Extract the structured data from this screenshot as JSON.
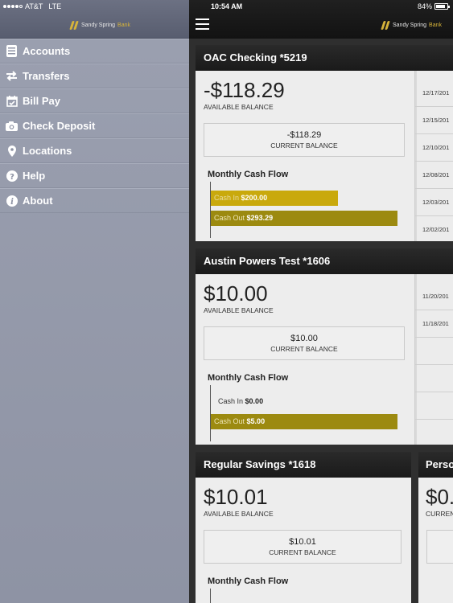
{
  "status_bar": {
    "carrier": "AT&T",
    "network": "LTE",
    "time": "10:54 AM",
    "battery": "84%",
    "battery_level": 0.84
  },
  "brand": {
    "name": "Sandy Spring",
    "suffix": "Bank"
  },
  "sidebar": {
    "items": [
      {
        "label": "Accounts",
        "icon": "accounts-icon"
      },
      {
        "label": "Transfers",
        "icon": "transfer-arrows-icon"
      },
      {
        "label": "Bill Pay",
        "icon": "calendar-check-icon"
      },
      {
        "label": "Check Deposit",
        "icon": "camera-icon"
      },
      {
        "label": "Locations",
        "icon": "map-pin-icon"
      },
      {
        "label": "Help",
        "icon": "question-icon"
      },
      {
        "label": "About",
        "icon": "info-icon"
      }
    ]
  },
  "labels": {
    "available_balance": "AVAILABLE BALANCE",
    "current_balance": "CURRENT BALANCE",
    "monthly_cash_flow": "Monthly Cash Flow",
    "cash_in": "Cash In",
    "cash_out": "Cash Out"
  },
  "accounts": [
    {
      "title": "OAC Checking *5219",
      "available": "-$118.29",
      "current": "-$118.29",
      "cash_in": "$200.00",
      "cash_out": "$293.29",
      "cash_in_value": 200.0,
      "cash_out_value": 293.29,
      "transactions": [
        "12/17/201",
        "12/15/201",
        "12/10/201",
        "12/08/201",
        "12/03/201",
        "12/02/201"
      ]
    },
    {
      "title": "Austin Powers Test *1606",
      "available": "$10.00",
      "current": "$10.00",
      "cash_in": "$0.00",
      "cash_out": "$5.00",
      "cash_in_value": 0.0,
      "cash_out_value": 5.0,
      "transactions": [
        "11/20/201",
        "11/18/201",
        "",
        "",
        "",
        ""
      ]
    },
    {
      "title": "Regular Savings *1618",
      "available": "$10.01",
      "current": "$10.01",
      "cash_in": "",
      "cash_out": ""
    },
    {
      "title": "Perso",
      "available": "$0.",
      "current_label": "CURREN"
    }
  ],
  "colors": {
    "cash_in_bar": "#c9a90c",
    "cash_out_bar": "#9c8a10",
    "brand_gold": "#d6b33a"
  }
}
